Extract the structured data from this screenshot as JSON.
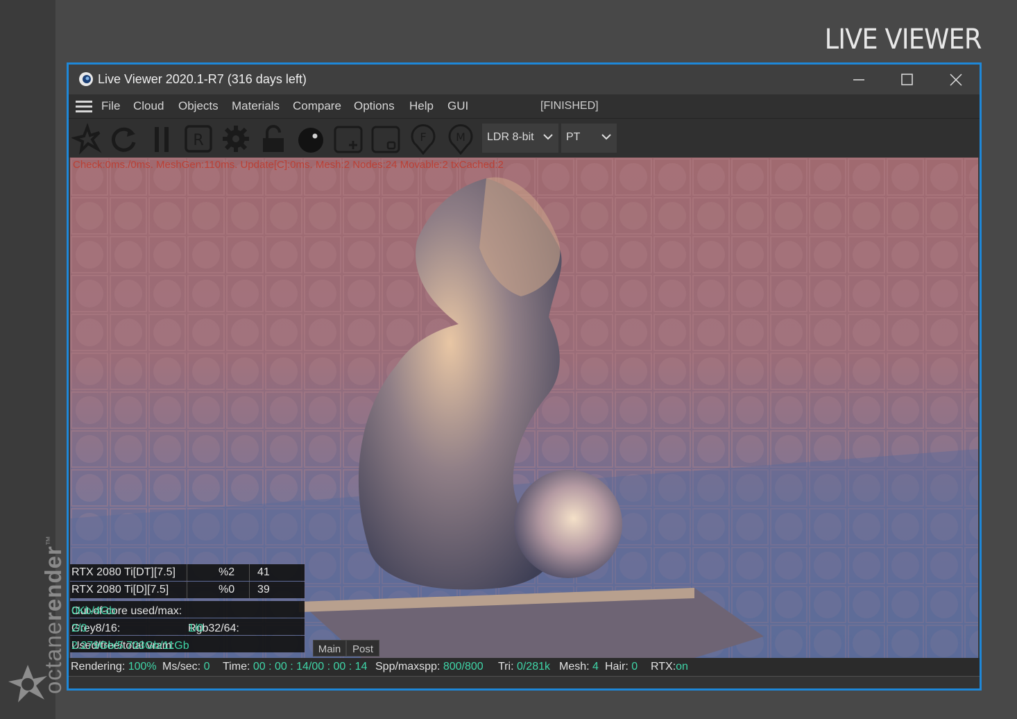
{
  "page": {
    "heading": "LIVE VIEWER"
  },
  "brand": {
    "word_light": "octane",
    "word_bold": "render",
    "tm": "™"
  },
  "window": {
    "title": "Live Viewer 2020.1-R7 (316 days left)",
    "accent_color": "#1e88d9"
  },
  "menu": {
    "items": [
      "File",
      "Cloud",
      "Objects",
      "Materials",
      "Compare",
      "Options",
      "Help",
      "GUI"
    ],
    "status": "[FINISHED]"
  },
  "toolbar": {
    "tools": [
      "send-scene-icon",
      "refresh-icon",
      "pause-icon",
      "render-region-icon",
      "settings-gear-icon",
      "unlock-icon",
      "clay-sphere-icon",
      "add-region-icon",
      "film-region-icon",
      "focus-picker-icon",
      "material-picker-icon"
    ],
    "tone_select": "LDR 8-bit",
    "kernel_select": "PT"
  },
  "viewport": {
    "debug": "Check:0ms./0ms. MeshGen:110ms. Update[C]:0ms. Mesh:2 Nodes:24 Movable:2 txCached:2"
  },
  "stats": {
    "gpus": [
      {
        "name": "RTX 2080 Ti[DT][7.5]",
        "usage": "%2",
        "temp": "41"
      },
      {
        "name": "RTX 2080 Ti[D][7.5]",
        "usage": "%0",
        "temp": "39"
      }
    ],
    "out_of_core_label": "Out-of-core used/max:",
    "out_of_core_value": "0Kb/4Gb",
    "grey_label": "Grey8/16: ",
    "grey_value": "2/0",
    "rgb_label": "Rgb32/64: ",
    "rgb_value": "1/0",
    "vram_label": "Used/free/total vram: ",
    "vram_value": "2.279Gb/5.703Gb/11Gb"
  },
  "tabs": [
    "Main",
    "Post"
  ],
  "status": {
    "rendering_label": "Rendering: ",
    "rendering_value": "100%",
    "ms_label": "Ms/sec: ",
    "ms_value": "0",
    "time_label": "Time: ",
    "time_value": "00 : 00 : 14/00 : 00 : 14",
    "spp_label": "Spp/maxspp: ",
    "spp_value": "800/800",
    "tri_label": "Tri: ",
    "tri_value": "0/281k",
    "mesh_label": "Mesh: ",
    "mesh_value": "4",
    "hair_label": "Hair: ",
    "hair_value": "0",
    "rtx_label": "RTX:",
    "rtx_value": "on"
  }
}
